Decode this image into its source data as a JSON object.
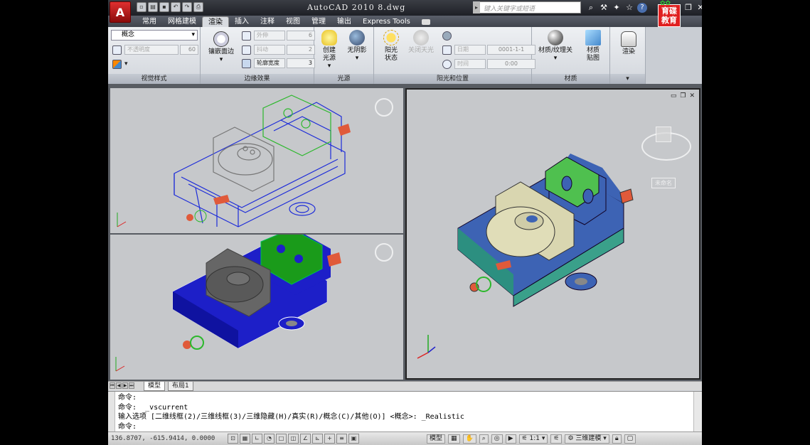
{
  "window": {
    "title": "AutoCAD 2010   8.dwg",
    "search_placeholder": "键入关键字或短语",
    "brand_text": "育碟教育"
  },
  "ribbon_tabs": [
    {
      "label": "常用"
    },
    {
      "label": "网格建模"
    },
    {
      "label": "渲染",
      "active": true
    },
    {
      "label": "插入"
    },
    {
      "label": "注释"
    },
    {
      "label": "视图"
    },
    {
      "label": "管理"
    },
    {
      "label": "输出"
    },
    {
      "label": "Express Tools"
    }
  ],
  "panels": {
    "visual_styles": {
      "title": "视觉样式",
      "current_style": "概念",
      "opacity_label": "不透明度",
      "opacity_value": "60"
    },
    "edge_effects": {
      "title": "边缘效果",
      "isolines_button": "镶嵌面边",
      "overhang_label": "外伸",
      "overhang_value": "6",
      "jitter_label": "抖动",
      "jitter_value": "2",
      "width_label": "轮廓宽度",
      "width_value": "3"
    },
    "lights": {
      "title": "光源",
      "create_light": "创建\n光源",
      "no_shadows": "无阴影"
    },
    "sun": {
      "title": "阳光和位置",
      "sun_status": "阳光\n状态",
      "sky_off": "关闭天光",
      "date_label": "日期",
      "date_value": "0001-1-1",
      "time_label": "时间",
      "time_value": "0:00"
    },
    "materials": {
      "title": "材质",
      "materials_toggle": "材质/纹理关",
      "material_mapping": "材质\n贴图"
    },
    "render": {
      "title": "",
      "render_button": "渲染"
    }
  },
  "viewports": {
    "top_left_style": "wireframe",
    "bottom_left_style": "shaded",
    "right_style": "conceptual",
    "viewcube_label": "未命名"
  },
  "layout_tabs": [
    {
      "label": "模型"
    },
    {
      "label": "布局1"
    }
  ],
  "command_line": {
    "lines": [
      "命令:",
      "命令:  _vscurrent",
      "输入选项 [二维线框(2)/三维线框(3)/三维隐藏(H)/真实(R)/概念(C)/其他(O)] <概念>: _Realistic",
      "命令:"
    ]
  },
  "status_bar": {
    "coordinates": "136.8707, -615.9414, 0.0000",
    "model_label": "模型",
    "scale": "1:1",
    "workspace": "三维建模"
  },
  "colors": {
    "accent_red": "#c81414",
    "ribbon_bg": "#e4e7eb",
    "viewport_bg": "#c6c8cb"
  }
}
